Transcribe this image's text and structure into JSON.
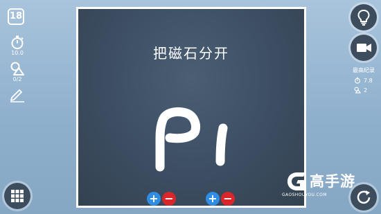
{
  "level": "18",
  "stats": {
    "time_value": "10.0",
    "shapes_value": "0/2"
  },
  "board": {
    "title": "把磁石分开"
  },
  "records": {
    "title": "最高纪录",
    "time": "7.8",
    "shapes": "2"
  },
  "watermark": {
    "name": "高手游",
    "domain": "GAOSHOUYOU.COM"
  },
  "icons": {
    "timer": "stopwatch-icon",
    "shapes": "shapes-icon",
    "draw": "pencil-icon",
    "hint": "lightbulb-icon",
    "video": "video-camera-icon",
    "menu": "grid-menu-icon",
    "restart": "restart-icon"
  },
  "colors": {
    "plus": "#2f8de4",
    "minus": "#d9262b",
    "board_bg": "#3b4c60"
  }
}
